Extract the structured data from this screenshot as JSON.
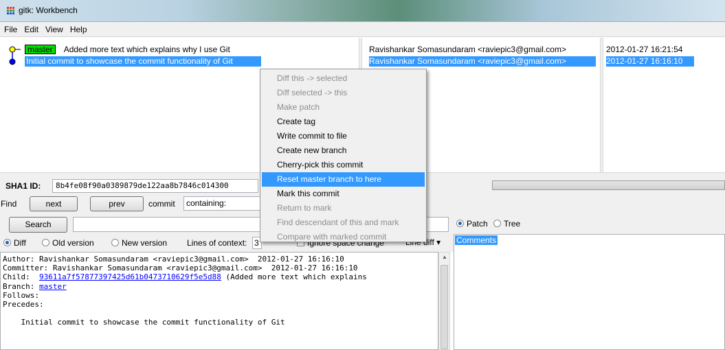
{
  "window": {
    "title": "gitk: Workbench"
  },
  "menu": [
    "File",
    "Edit",
    "View",
    "Help"
  ],
  "commits": [
    {
      "branch": "master",
      "message": "Added more text which explains why I use Git",
      "author": "Ravishankar Somasundaram <raviepic3@gmail.com>",
      "date": "2012-01-27 16:21:54",
      "selected": false
    },
    {
      "branch": "",
      "message": "Initial commit to showcase the commit functionality of Git",
      "author": "Ravishankar Somasundaram <raviepic3@gmail.com>",
      "date": "2012-01-27 16:16:10",
      "selected": true
    }
  ],
  "sha": {
    "label": "SHA1 ID:",
    "value": "8b4fe08f90a0389879de122aa8b7846c014300"
  },
  "find": {
    "label": "Find",
    "next": "next",
    "prev": "prev",
    "commit_label": "commit",
    "containing": "containing:"
  },
  "search": {
    "button": "Search"
  },
  "diff_options": {
    "diff": "Diff",
    "old_version": "Old version",
    "new_version": "New version",
    "lines_of_context_label": "Lines of context:",
    "lines_of_context_value": "3",
    "ignore_space": "Ignore space change",
    "line_diff": "Line diff"
  },
  "right_options": {
    "patch": "Patch",
    "tree": "Tree",
    "comments": "Comments"
  },
  "diff_text": {
    "author": "Author: Ravishankar Somasundaram <raviepic3@gmail.com>  2012-01-27 16:16:10",
    "committer": "Committer: Ravishankar Somasundaram <raviepic3@gmail.com>  2012-01-27 16:16:10",
    "child_label": "Child:  ",
    "child_hash": "93611a7f57877397425d61b0473710629f5e5d88",
    "child_desc": " (Added more text which explains",
    "branch_label": "Branch: ",
    "branch_link": "master",
    "follows": "Follows:",
    "precedes": "Precedes:",
    "body": "    Initial commit to showcase the commit functionality of Git"
  },
  "context_menu": [
    {
      "label": "Diff this -> selected",
      "state": "disabled"
    },
    {
      "label": "Diff selected -> this",
      "state": "disabled"
    },
    {
      "label": "Make patch",
      "state": "disabled"
    },
    {
      "label": "Create tag",
      "state": "enabled"
    },
    {
      "label": "Write commit to file",
      "state": "enabled"
    },
    {
      "label": "Create new branch",
      "state": "enabled"
    },
    {
      "label": "Cherry-pick this commit",
      "state": "enabled"
    },
    {
      "label": "Reset master branch to here",
      "state": "active"
    },
    {
      "label": "Mark this commit",
      "state": "enabled"
    },
    {
      "label": "Return to mark",
      "state": "disabled"
    },
    {
      "label": "Find descendant of this and mark",
      "state": "disabled"
    },
    {
      "label": "Compare with marked commit",
      "state": "disabled"
    }
  ],
  "colors": {
    "selection": "#3399ff",
    "branch_tag": "#00e000",
    "head_dot": "#ffff00",
    "commit_dot": "#0000ff",
    "graph_line": "#0000ff"
  }
}
